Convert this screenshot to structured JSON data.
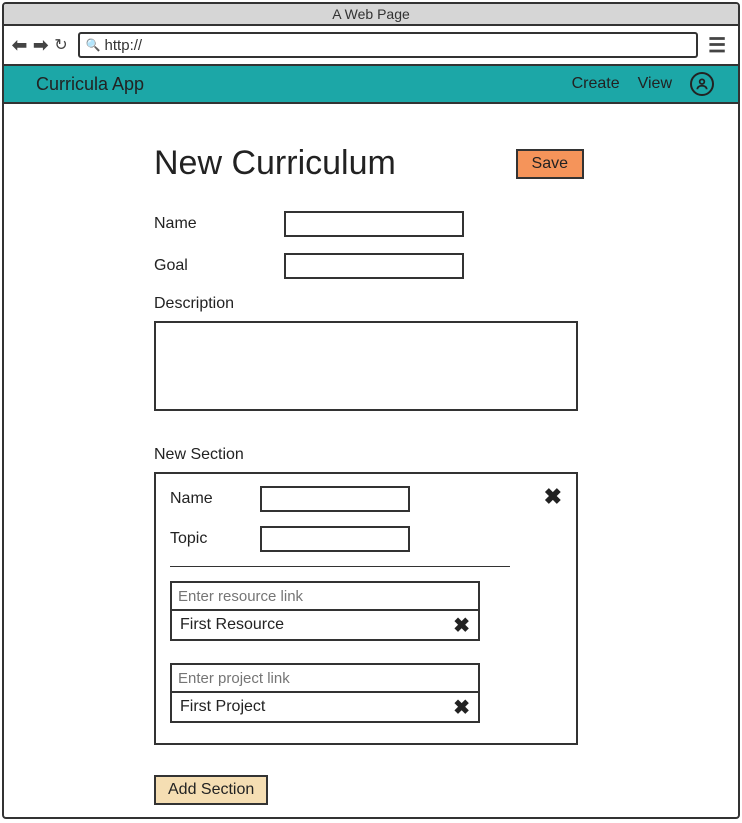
{
  "window": {
    "title": "A Web Page",
    "url_prefix": "http://"
  },
  "app": {
    "title": "Curricula App",
    "nav": {
      "create": "Create",
      "view": "View"
    }
  },
  "page": {
    "title": "New Curriculum",
    "save_label": "Save",
    "fields": {
      "name_label": "Name",
      "name_value": "",
      "goal_label": "Goal",
      "goal_value": "",
      "description_label": "Description",
      "description_value": ""
    },
    "section": {
      "label": "New Section",
      "name_label": "Name",
      "name_value": "",
      "topic_label": "Topic",
      "topic_value": "",
      "resource_placeholder": "Enter resource link",
      "resource_item": "First Resource",
      "project_placeholder": "Enter project link",
      "project_item": "First Project"
    },
    "add_section_label": "Add Section"
  }
}
